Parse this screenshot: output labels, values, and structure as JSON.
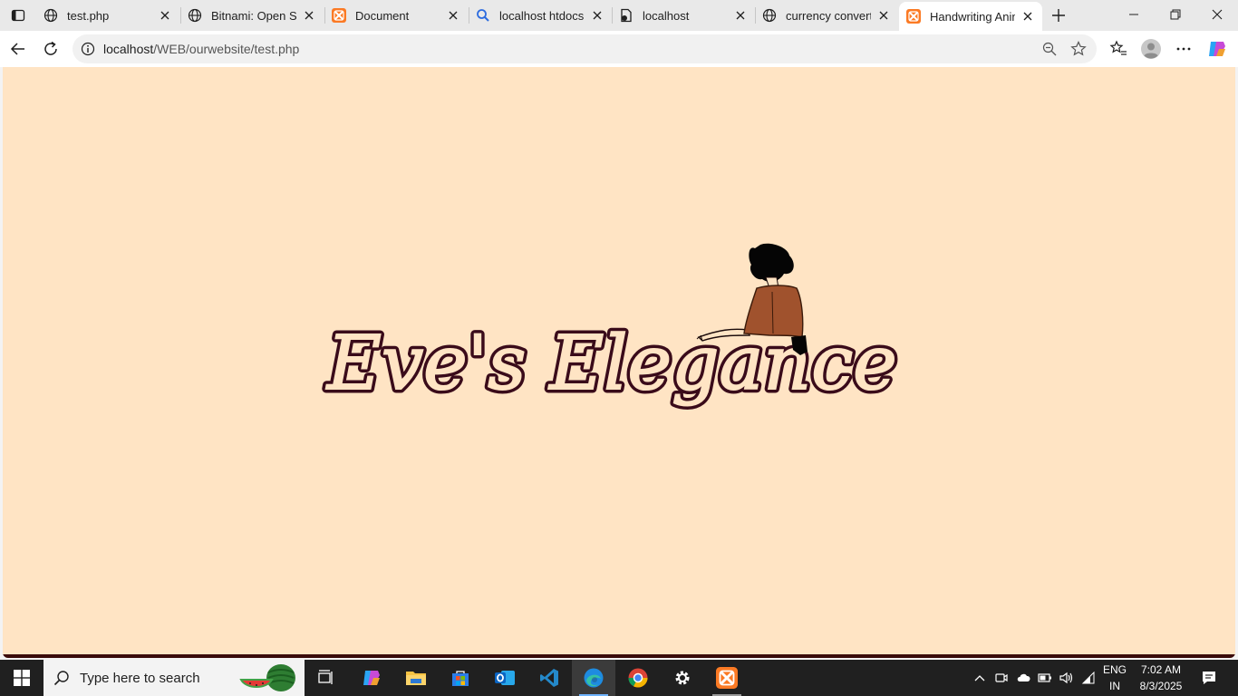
{
  "browser": {
    "tabs": [
      {
        "title": "test.php",
        "icon": "globe-icon"
      },
      {
        "title": "Bitnami: Open Sou",
        "icon": "globe-icon"
      },
      {
        "title": "Document",
        "icon": "xampp-icon"
      },
      {
        "title": "localhost htdocs ir",
        "icon": "search-icon"
      },
      {
        "title": "localhost",
        "icon": "file-icon"
      },
      {
        "title": "currency converte",
        "icon": "globe-icon"
      },
      {
        "title": "Handwriting Anim",
        "icon": "xampp-icon",
        "active": true
      }
    ],
    "address": {
      "host": "localhost",
      "path": "/WEB/ourwebsite/test.php"
    }
  },
  "page": {
    "logo_text": "Eve's Elegance",
    "background": "#ffe4c4",
    "text_color": "#3a0b1a",
    "figure_dress_color": "#a0522d",
    "figure_hair_color": "#000000"
  },
  "taskbar": {
    "search_placeholder": "Type here to search",
    "language_line1": "ENG",
    "language_line2": "IN",
    "time": "7:02 AM",
    "date": "8/3/2025"
  }
}
